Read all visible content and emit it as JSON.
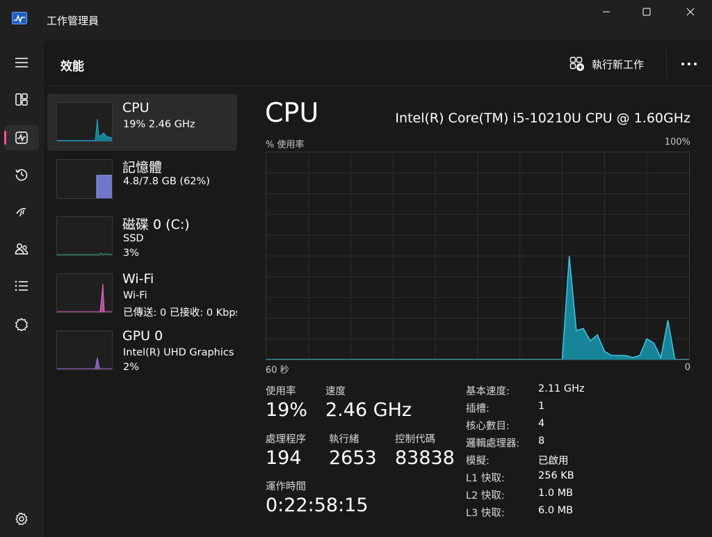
{
  "window": {
    "title": "工作管理員",
    "icon": "task-manager-icon"
  },
  "nav": {
    "items": [
      {
        "icon": "hamburger-menu-icon",
        "name": "menu"
      },
      {
        "icon": "processes-icon",
        "name": "processes"
      },
      {
        "icon": "performance-icon",
        "name": "performance",
        "active": true
      },
      {
        "icon": "app-history-icon",
        "name": "app-history"
      },
      {
        "icon": "startup-apps-icon",
        "name": "startup-apps"
      },
      {
        "icon": "users-icon",
        "name": "users"
      },
      {
        "icon": "details-icon",
        "name": "details"
      },
      {
        "icon": "services-icon",
        "name": "services"
      },
      {
        "icon": "settings-icon",
        "name": "settings"
      }
    ],
    "accent_color": "#ff4f9e"
  },
  "header": {
    "title": "效能",
    "run_task_label": "執行新工作",
    "more_label": "•••"
  },
  "devices": [
    {
      "name": "CPU",
      "line1": "19%  2.46 GHz",
      "line2": "",
      "color": "#17a8c6",
      "selected": true
    },
    {
      "name": "記憶體",
      "line1": "4.8/7.8 GB (62%)",
      "line2": "",
      "color": "#7b7fdc"
    },
    {
      "name": "磁碟 0 (C:)",
      "line1": "SSD",
      "line2": "3%",
      "color": "#2bb59a"
    },
    {
      "name": "Wi-Fi",
      "line1": "Wi-Fi",
      "line2": "已傳送: 0  已接收: 0 Kbps",
      "color": "#e266c7"
    },
    {
      "name": "GPU 0",
      "line1": "Intel(R) UHD Graphics",
      "line2": "2%",
      "color": "#a66dd4"
    }
  ],
  "detail": {
    "title": "CPU",
    "model": "Intel(R) Core(TM) i5-10210U CPU @ 1.60GHz",
    "y_axis_label": "% 使用率",
    "y_axis_max": "100%",
    "x_axis_left": "60 秒",
    "x_axis_right": "0",
    "stats": {
      "utilization_label": "使用率",
      "utilization_value": "19%",
      "speed_label": "速度",
      "speed_value": "2.46 GHz",
      "processes_label": "處理程序",
      "processes_value": "194",
      "threads_label": "執行緒",
      "threads_value": "2653",
      "handles_label": "控制代碼",
      "handles_value": "83838",
      "uptime_label": "運作時間",
      "uptime_value": "0:22:58:15"
    },
    "specs": [
      {
        "key": "基本速度:",
        "value": "2.11 GHz"
      },
      {
        "key": "插槽:",
        "value": "1"
      },
      {
        "key": "核心數目:",
        "value": "4"
      },
      {
        "key": "邏輯處理器:",
        "value": "8"
      },
      {
        "key": "模擬:",
        "value": "已啟用"
      },
      {
        "key": "L1 快取:",
        "value": "256 KB"
      },
      {
        "key": "L2 快取:",
        "value": "1.0 MB"
      },
      {
        "key": "L3 快取:",
        "value": "6.0 MB"
      }
    ]
  },
  "chart_data": {
    "type": "area",
    "xlabel": "60 秒",
    "ylabel": "% 使用率",
    "xlim": [
      60,
      0
    ],
    "ylim": [
      0,
      100
    ],
    "grid": true,
    "color": "#17a8c6",
    "series": [
      {
        "x": [
          60,
          59,
          58,
          57,
          56,
          55,
          54,
          53,
          52,
          51,
          50,
          49,
          48,
          47,
          46,
          45,
          44,
          43,
          42,
          41,
          40,
          39,
          38,
          37,
          36,
          35,
          34,
          33,
          32,
          31,
          30,
          29,
          28,
          27,
          26,
          25,
          24,
          23,
          22,
          21,
          20,
          19,
          18,
          17,
          16,
          15,
          14,
          13,
          12,
          11,
          10,
          9,
          8,
          7,
          6,
          5,
          4,
          3,
          2,
          1,
          0
        ],
        "values": [
          0,
          0,
          0,
          0,
          0,
          0,
          0,
          0,
          0,
          0,
          0,
          0,
          0,
          0,
          0,
          0,
          0,
          0,
          0,
          0,
          0,
          0,
          0,
          0,
          0,
          0,
          0,
          0,
          0,
          0,
          0,
          0,
          0,
          0,
          0,
          0,
          0,
          0,
          0,
          0,
          0,
          0,
          0,
          50,
          14,
          15,
          9,
          12,
          4,
          2,
          2,
          2,
          1,
          2,
          10,
          8,
          1,
          19,
          0,
          0,
          0
        ]
      }
    ]
  }
}
